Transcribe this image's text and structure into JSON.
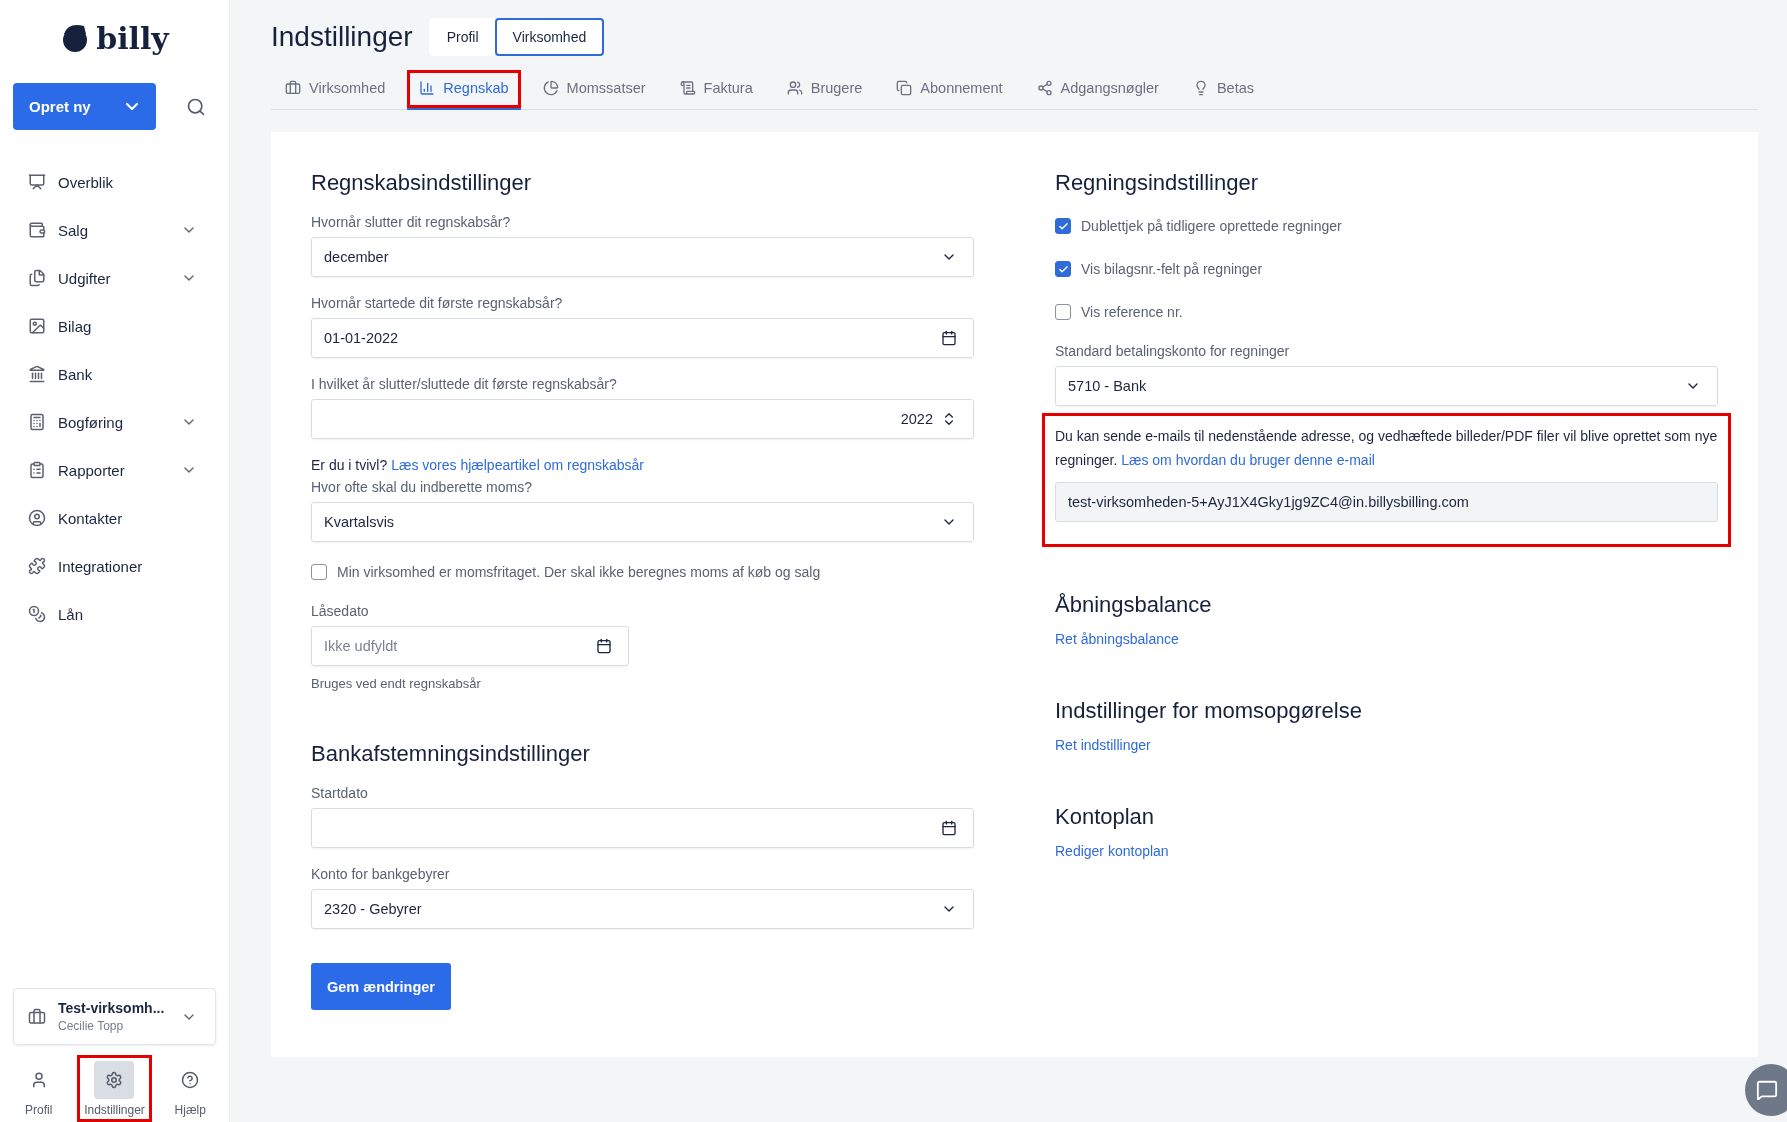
{
  "sidebar": {
    "logo": "billy",
    "create_button": "Opret ny",
    "nav": [
      {
        "label": "Overblik",
        "expandable": false
      },
      {
        "label": "Salg",
        "expandable": true
      },
      {
        "label": "Udgifter",
        "expandable": true
      },
      {
        "label": "Bilag",
        "expandable": false
      },
      {
        "label": "Bank",
        "expandable": false
      },
      {
        "label": "Bogføring",
        "expandable": true
      },
      {
        "label": "Rapporter",
        "expandable": true
      },
      {
        "label": "Kontakter",
        "expandable": false
      },
      {
        "label": "Integrationer",
        "expandable": false
      },
      {
        "label": "Lån",
        "expandable": false
      }
    ],
    "company": {
      "name": "Test-virksomh...",
      "user": "Cecilie Topp"
    },
    "bottom_nav": [
      {
        "label": "Profil",
        "selected": false,
        "highlighted": false
      },
      {
        "label": "Indstillinger",
        "selected": true,
        "highlighted": true
      },
      {
        "label": "Hjælp",
        "selected": false,
        "highlighted": false
      }
    ]
  },
  "header": {
    "title": "Indstillinger",
    "segments": [
      {
        "label": "Profil",
        "selected": false
      },
      {
        "label": "Virksomhed",
        "selected": true
      }
    ],
    "tabs": [
      {
        "label": "Virksomhed",
        "selected": false,
        "highlighted": false
      },
      {
        "label": "Regnskab",
        "selected": true,
        "highlighted": true
      },
      {
        "label": "Momssatser",
        "selected": false,
        "highlighted": false
      },
      {
        "label": "Faktura",
        "selected": false,
        "highlighted": false
      },
      {
        "label": "Brugere",
        "selected": false,
        "highlighted": false
      },
      {
        "label": "Abonnement",
        "selected": false,
        "highlighted": false
      },
      {
        "label": "Adgangsnøgler",
        "selected": false,
        "highlighted": false
      },
      {
        "label": "Betas",
        "selected": false,
        "highlighted": false
      }
    ]
  },
  "left_column": [
    {
      "kind": "heading",
      "text": "Regnskabsindstillinger"
    },
    {
      "kind": "select",
      "label": "Hvornår slutter dit regnskabsår?",
      "value": "december"
    },
    {
      "kind": "date",
      "label": "Hvornår startede dit første regnskabsår?",
      "value": "01-01-2022"
    },
    {
      "kind": "number",
      "label": "I hvilket år slutter/sluttede dit første regnskabsår?",
      "value": "2022"
    },
    {
      "kind": "help",
      "text": "Er du i tvivl?",
      "link": "Læs vores hjælpeartikel om regnskabsår"
    },
    {
      "kind": "select",
      "label": "Hvor ofte skal du indberette moms?",
      "value": "Kvartalsvis"
    },
    {
      "kind": "checkbox",
      "label": "Min virksomhed er momsfritaget. Der skal ikke beregnes moms af køb og salg",
      "checked": false
    },
    {
      "kind": "smalldate",
      "label": "Låsedato",
      "placeholder": "Ikke udfyldt",
      "hint": "Bruges ved endt regnskabsår"
    },
    {
      "kind": "heading",
      "text": "Bankafstemningsindstillinger"
    },
    {
      "kind": "date",
      "label": "Startdato"
    },
    {
      "kind": "select",
      "label": "Konto for bankgebyrer",
      "value": "2320 - Gebyrer"
    }
  ],
  "save_button": "Gem ændringer",
  "right_column": [
    {
      "kind": "heading",
      "text": "Regningsindstillinger"
    },
    {
      "kind": "checkbox",
      "label": "Dublettjek på tidligere oprettede regninger",
      "checked": true
    },
    {
      "kind": "checkbox",
      "label": "Vis bilagsnr.-felt på regninger",
      "checked": true
    },
    {
      "kind": "checkbox",
      "label": "Vis reference nr.",
      "checked": false
    },
    {
      "kind": "select",
      "label": "Standard betalingskonto for regninger",
      "value": "5710 - Bank"
    },
    {
      "kind": "email",
      "text": "Du kan sende e-mails til nedenstående adresse, og vedhæftede billeder/PDF filer vil blive oprettet som nye regninger.",
      "link": "Læs om hvordan du bruger denne e-mail",
      "value": "test-virksomheden-5+AyJ1X4Gky1jg9ZC4@in.billysbilling.com",
      "highlighted": true
    },
    {
      "kind": "heading",
      "text": "Åbningsbalance"
    },
    {
      "kind": "link",
      "text": "Ret åbningsbalance"
    },
    {
      "kind": "heading",
      "text": "Indstillinger for momsopgørelse"
    },
    {
      "kind": "link",
      "text": "Ret indstillinger"
    },
    {
      "kind": "heading",
      "text": "Kontoplan"
    },
    {
      "kind": "link",
      "text": "Rediger kontoplan"
    }
  ]
}
